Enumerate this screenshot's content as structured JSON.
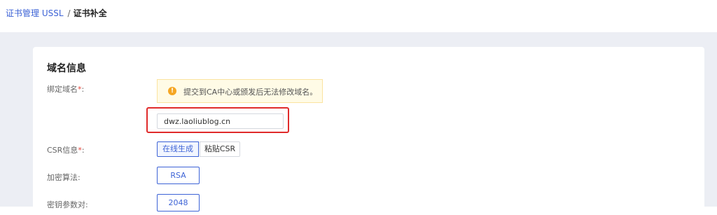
{
  "breadcrumb": {
    "parent": "证书管理 USSL",
    "separator": "/",
    "current": "证书补全"
  },
  "section": {
    "title": "域名信息"
  },
  "fields": {
    "bind_domain": {
      "label": "绑定域名",
      "required_mark": "*",
      "colon": ":",
      "notice_icon": "!",
      "notice": "提交到CA中心或颁发后无法修改域名。",
      "value": "dwz.laoliublog.cn"
    },
    "csr": {
      "label": "CSR信息",
      "required_mark": "*",
      "colon": ":",
      "options": [
        "在线生成",
        "粘贴CSR"
      ],
      "selected": "在线生成"
    },
    "algorithm": {
      "label": "加密算法:",
      "value": "RSA"
    },
    "key_param": {
      "label": "密钥参数对:",
      "value": "2048"
    }
  },
  "colors": {
    "accent": "#3d63d6",
    "highlight_border": "#e02b2b",
    "notice_bg": "#fffbe6",
    "page_bg": "#eceef4"
  }
}
